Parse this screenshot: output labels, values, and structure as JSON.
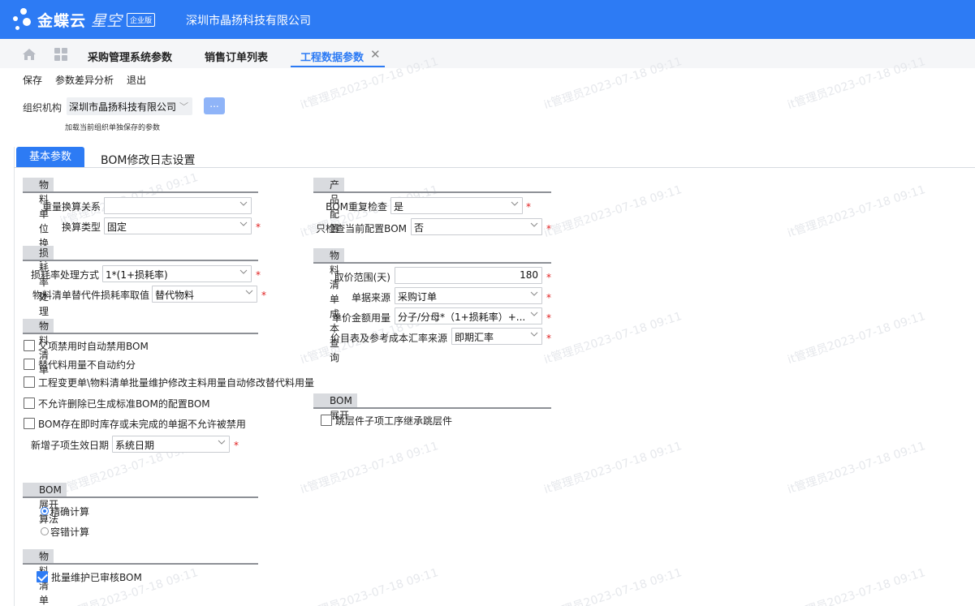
{
  "header": {
    "brand": "金蝶云",
    "brand_sub": "星空",
    "edition": "企业版",
    "company": "深圳市晶扬科技有限公司"
  },
  "tabs": [
    {
      "label": "采购管理系统参数"
    },
    {
      "label": "销售订单列表"
    },
    {
      "label": "工程数据参数"
    }
  ],
  "toolbar": {
    "save": "保存",
    "diff": "参数差异分析",
    "exit": "退出"
  },
  "org": {
    "label": "组织机构",
    "value": "深圳市晶扬科技有限公司",
    "more": "...",
    "hint": "加载当前组织单独保存的参数"
  },
  "subtabs": {
    "basic": "基本参数",
    "bom_log": "BOM修改日志设置"
  },
  "sections": {
    "unit_conv": {
      "title": "物料单位换算",
      "weight_rel_label": "重量换算关系",
      "weight_rel_value": "",
      "conv_type_label": "换算类型",
      "conv_type_value": "固定"
    },
    "loss": {
      "title": "损耗率处理",
      "method_label": "损耗率处理方式",
      "method_value": "1*(1+损耗率)",
      "subst_label": "物料清单替代件损耗率取值",
      "subst_value": "替代物料"
    },
    "bom": {
      "title": "物料清单",
      "cb1": "父项禁用时自动禁用BOM",
      "cb2": "替代料用量不自动约分",
      "cb3": "工程变更单\\物料清单批量维护修改主料用量自动修改替代料用量",
      "cb4": "不允许删除已生成标准BOM的配置BOM",
      "cb5": "BOM存在即时库存或未完成的单据不允许被禁用",
      "new_date_label": "新增子项生效日期",
      "new_date_value": "系统日期"
    },
    "expand_algo": {
      "title": "BOM展开算法",
      "opt1": "精确计算",
      "opt2": "容错计算"
    },
    "batch": {
      "title": "物料清单批量维护",
      "cb1": "批量维护已审核BOM"
    },
    "product": {
      "title": "产品配置",
      "dup_label": "BOM重复检查",
      "dup_value": "是",
      "cur_label": "只检查当前配置BOM",
      "cur_value": "否"
    },
    "cost": {
      "title": "物料清单成本查询",
      "range_label": "取价范围(天)",
      "range_value": "180",
      "source_label": "单据来源",
      "source_value": "采购订单",
      "price_label": "单价金额用量",
      "price_value": "分子/分母*（1+损耗率）+...",
      "rate_label": "价目表及参考成本汇率来源",
      "rate_value": "即期汇率"
    },
    "bom_expand": {
      "title": "BOM展开",
      "cb1": "跳层件子项工序继承跳层件"
    }
  },
  "watermark": "it管理员2023-07-18 09:11",
  "colors": {
    "accent": "#2d7bf4",
    "required": "#e02020"
  }
}
